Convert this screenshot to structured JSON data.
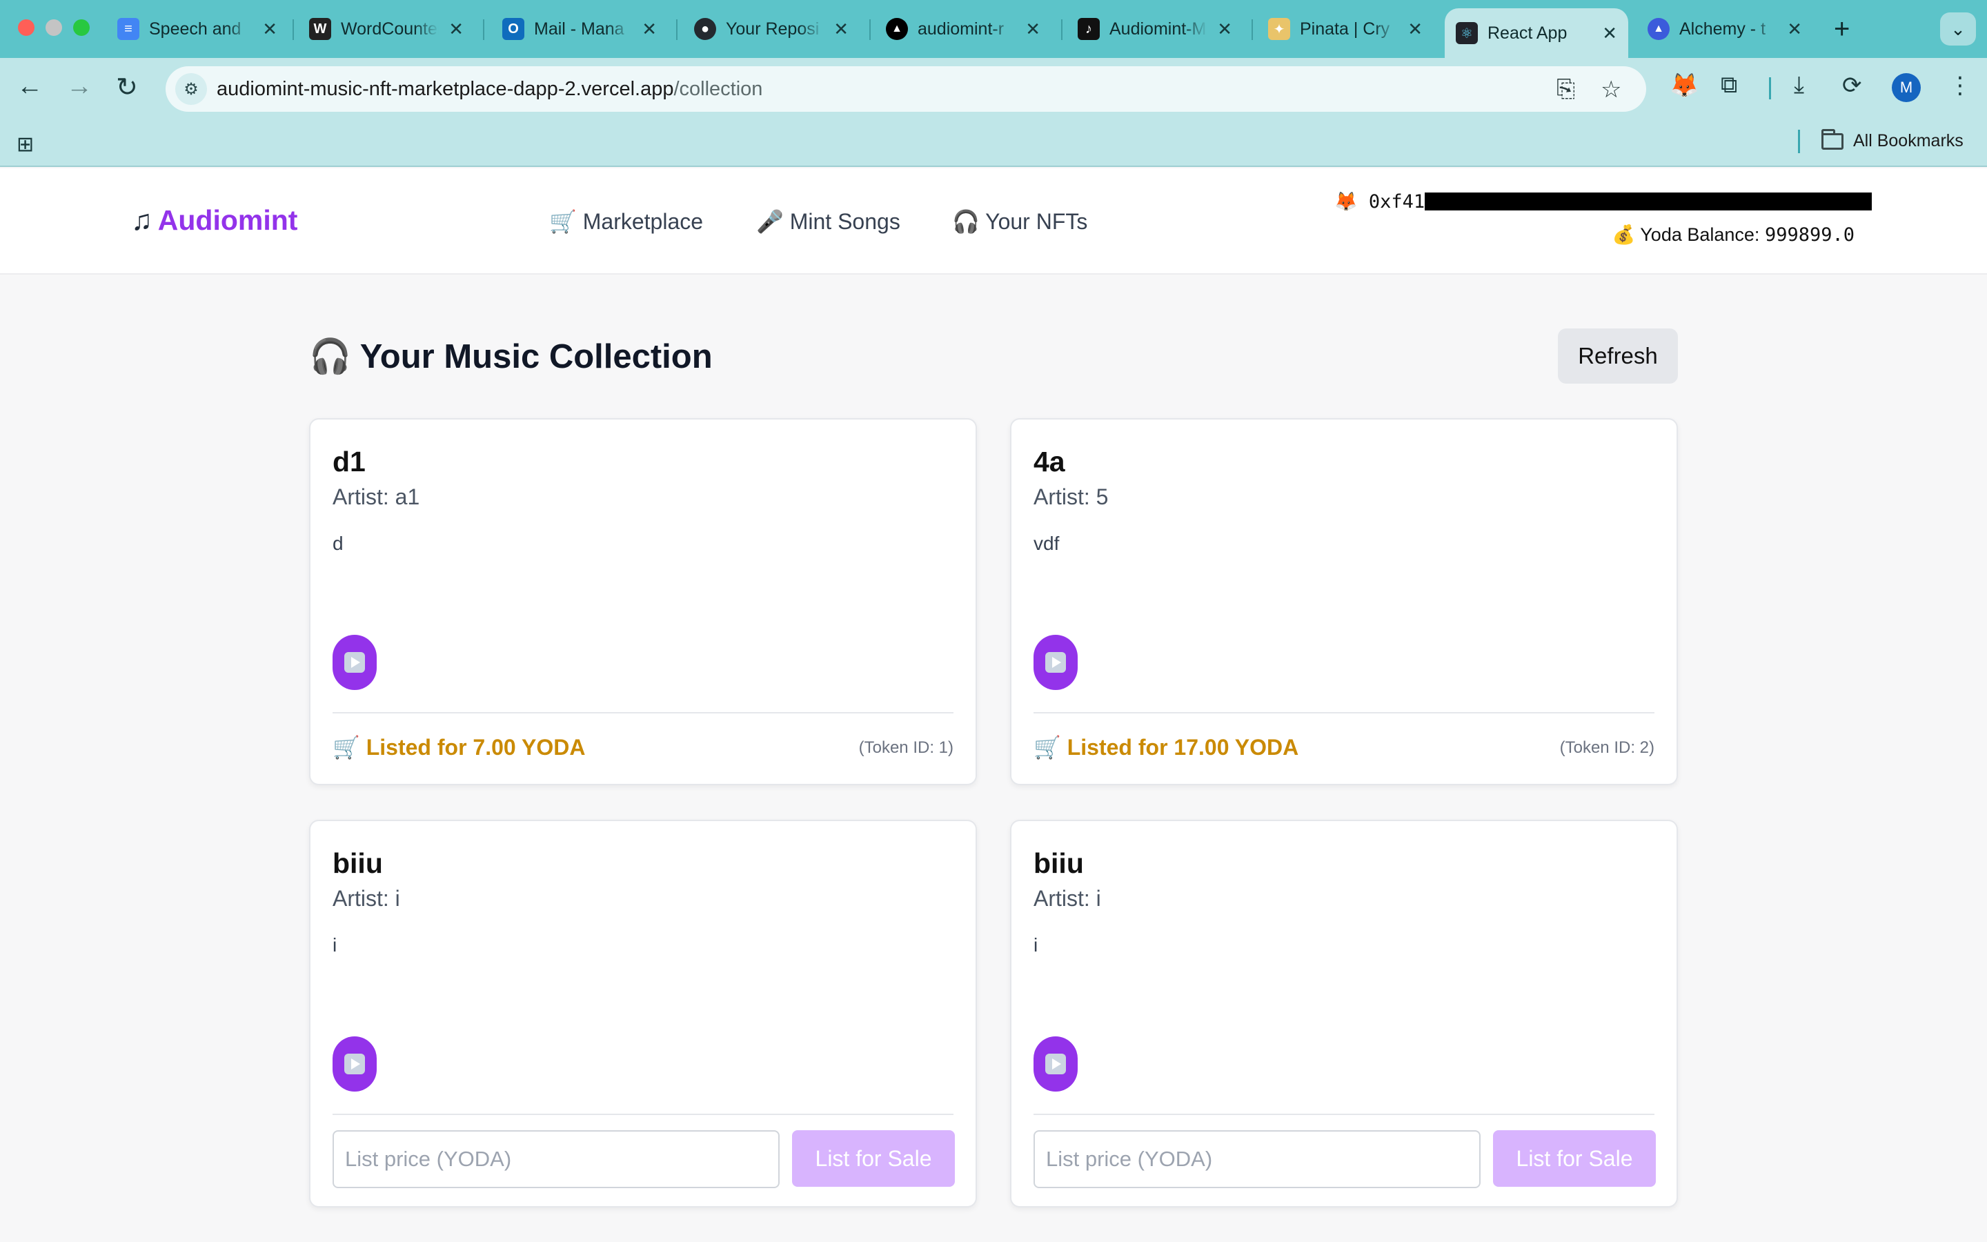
{
  "browser": {
    "tabs": [
      {
        "title": "Speech and",
        "icon": "docs-icon"
      },
      {
        "title": "WordCounter",
        "icon": "wordcounter-icon"
      },
      {
        "title": "Mail - Mana",
        "icon": "outlook-icon"
      },
      {
        "title": "Your Reposi",
        "icon": "github-icon"
      },
      {
        "title": "audiomint-r",
        "icon": "vercel-icon"
      },
      {
        "title": "Audiomint-M",
        "icon": "app-icon"
      },
      {
        "title": "Pinata | Cry",
        "icon": "pinata-icon"
      },
      {
        "title": "React App",
        "icon": "react-icon",
        "active": true
      },
      {
        "title": "Alchemy - t",
        "icon": "alchemy-icon"
      }
    ],
    "url_host": "audiomint-music-nft-marketplace-dapp-2.vercel.app",
    "url_path": "/collection",
    "bookmarks_label": "All Bookmarks",
    "profile_initial": "M"
  },
  "app": {
    "brand_icon": "♫",
    "brand": "Audiomint",
    "nav": [
      {
        "icon": "🛒",
        "label": "Marketplace"
      },
      {
        "icon": "🎤",
        "label": "Mint Songs"
      },
      {
        "icon": "🎧",
        "label": "Your NFTs"
      }
    ],
    "wallet_icon": "🦊",
    "wallet_prefix": "0xf41",
    "balance_label": "💰 Yoda Balance:",
    "balance_value": "999899.0",
    "accent_color": "#9333ea"
  },
  "collection": {
    "title_icon": "🎧",
    "title": "Your Music Collection",
    "refresh_label": "Refresh",
    "songs": [
      {
        "title": "d1",
        "artist": "Artist: a1",
        "description": "d",
        "listed_icon": "🛒",
        "listed_text": "Listed for 7.00 YODA",
        "token": "(Token ID: 1)"
      },
      {
        "title": "4a",
        "artist": "Artist: 5",
        "description": "vdf",
        "listed_icon": "🛒",
        "listed_text": "Listed for 17.00 YODA",
        "token": "(Token ID: 2)"
      },
      {
        "title": "biiu",
        "artist": "Artist: i",
        "description": "i",
        "price_placeholder": "List price (YODA)",
        "list_label": "List for Sale"
      },
      {
        "title": "biiu",
        "artist": "Artist: i",
        "description": "i",
        "price_placeholder": "List price (YODA)",
        "list_label": "List for Sale"
      }
    ]
  }
}
